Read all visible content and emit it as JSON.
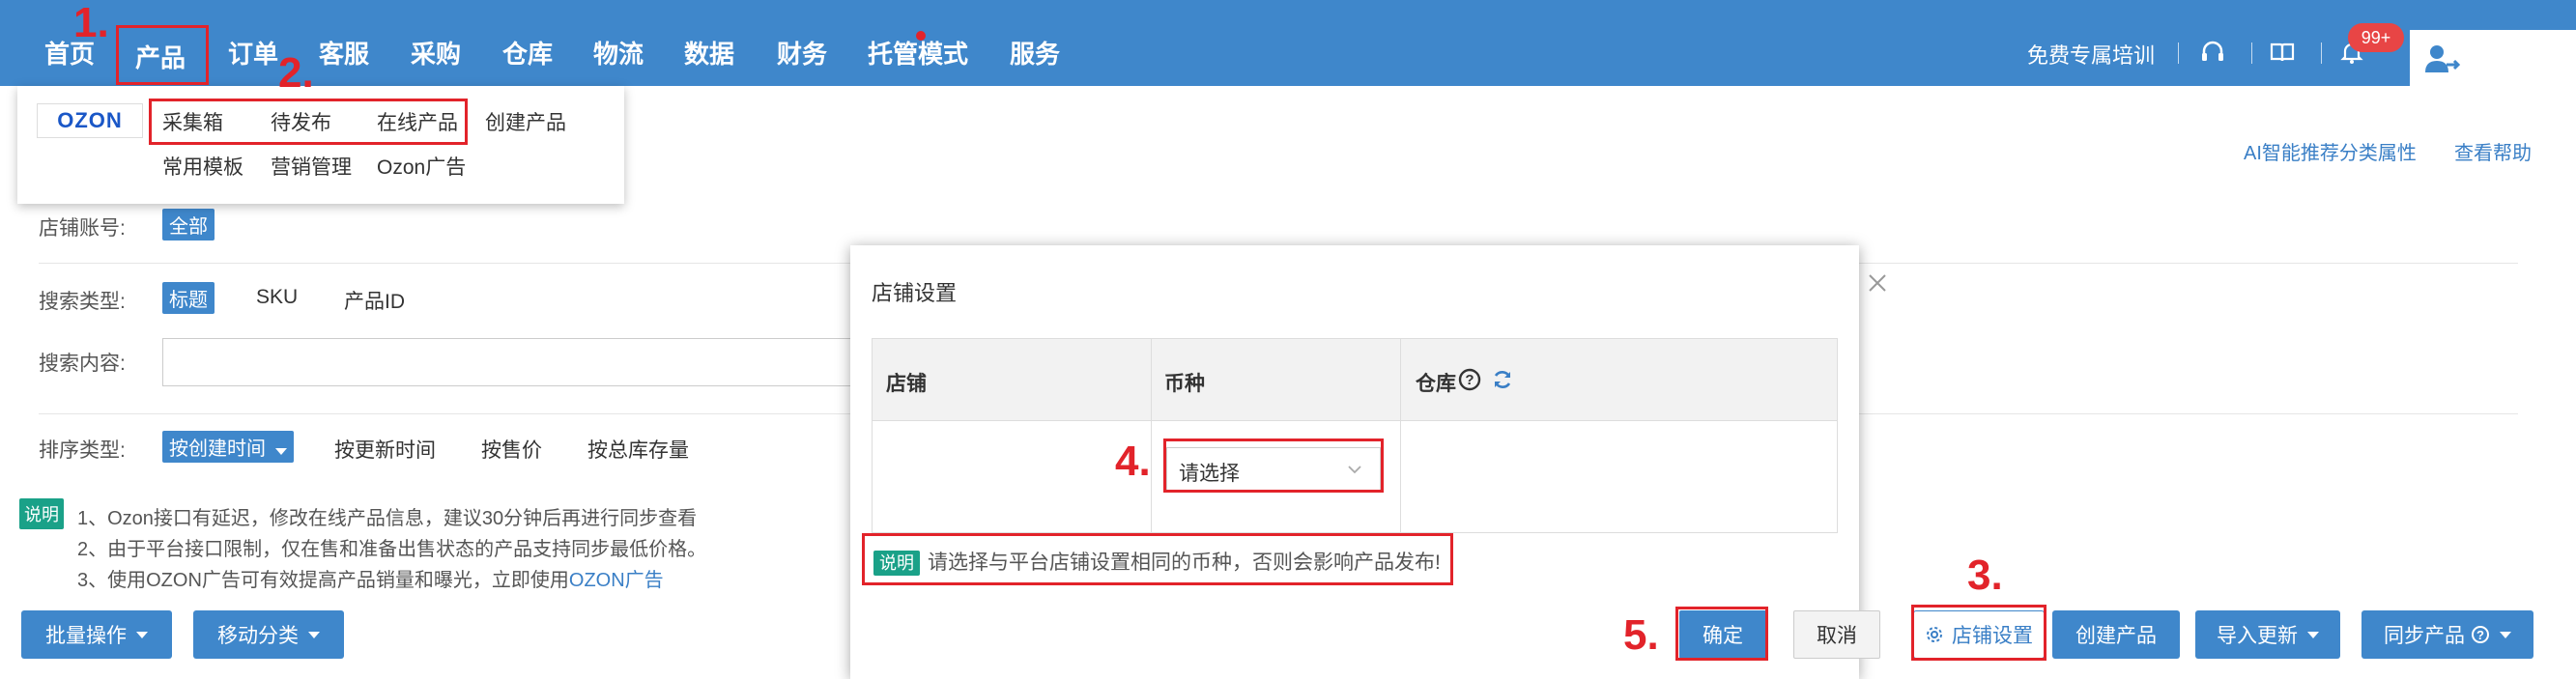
{
  "nav": {
    "items": [
      "首页",
      "产品",
      "订单",
      "客服",
      "采购",
      "仓库",
      "物流",
      "数据",
      "财务",
      "托管模式",
      "服务"
    ],
    "training_link": "免费专属培训",
    "notification_badge": "99+"
  },
  "product_menu": {
    "logo": "OZON",
    "row1": [
      "采集箱",
      "待发布",
      "在线产品",
      "创建产品"
    ],
    "row2": [
      "常用模板",
      "营销管理",
      "Ozon广告"
    ]
  },
  "help_links": {
    "ai": "AI智能推荐分类属性",
    "help": "查看帮助"
  },
  "filters": {
    "store": {
      "label": "店铺账号:",
      "selected": "全部"
    },
    "search_type": {
      "label": "搜索类型:",
      "selected": "标题",
      "options": [
        "SKU",
        "产品ID"
      ]
    },
    "search_content": {
      "label": "搜索内容:",
      "value": ""
    },
    "sort": {
      "label": "排序类型:",
      "selected": "按创建时间",
      "options": [
        "按更新时间",
        "按售价",
        "按总库存量"
      ]
    }
  },
  "notes": {
    "tag": "说明",
    "line1": "1、Ozon接口有延迟，修改在线产品信息，建议30分钟后再进行同步查看",
    "line2": "2、由于平台接口限制，仅在售和准备出售状态的产品支持同步最低价格。",
    "line3_prefix": "3、使用OZON广告可有效提高产品销量和曝光，立即使用",
    "line3_link": "OZON广告"
  },
  "bottom_buttons": {
    "batch": "批量操作",
    "move": "移动分类",
    "store_settings": "店铺设置",
    "create": "创建产品",
    "import": "导入更新",
    "sync": "同步产品"
  },
  "modal": {
    "title": "店铺设置",
    "columns": [
      "店铺",
      "币种",
      "仓库"
    ],
    "currency_placeholder": "请选择",
    "note_tag": "说明",
    "note": "请选择与平台店铺设置相同的币种，否则会影响产品发布!",
    "ok": "确定",
    "cancel": "取消"
  },
  "annotations": [
    "1.",
    "2.",
    "3.",
    "4.",
    "5."
  ],
  "colors": {
    "nav_bg": "#3f87cb",
    "accent": "#3f87cb",
    "annotation_red": "#e2232a",
    "note_green": "#1aa188"
  }
}
